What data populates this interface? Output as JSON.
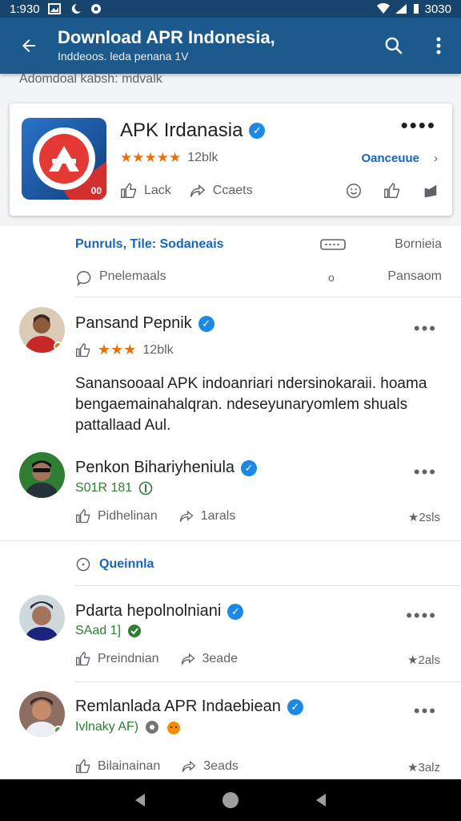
{
  "status_bar": {
    "time": "1:930",
    "right_text": "3030",
    "icons": [
      "photo-icon",
      "moon-icon",
      "location-icon",
      "wifi-icon",
      "signal-icon",
      "battery-icon"
    ]
  },
  "app_bar": {
    "title": "Download APR Indonesia,",
    "subtitle": "Inddeoos. leda penana 1V",
    "icons": [
      "back-arrow-icon",
      "search-icon",
      "more-vert-icon"
    ]
  },
  "breadcrumb": "Adomdoal kabsh: mdvalk",
  "app_card": {
    "name": "APK Irdanasia",
    "rating_stars": "★★★★★",
    "rating_count": "12blk",
    "link_label": "Oanceuue",
    "link_chevron": "›",
    "icon_corner_text": "00",
    "like_label": "Lack",
    "share_label": "Ccaets"
  },
  "info": {
    "row1_left": "Punruls, Tile: Sodaneais",
    "row1_right": "Bornieia",
    "row2_left": "Pnelemaals",
    "row2_mid": "o",
    "row2_right": "Pansaom"
  },
  "posts": [
    {
      "author": "Pansand Pepnik",
      "rating_stars": "★★★",
      "rating_count": "12blk",
      "body": "Sanansooaal APK indoanriari ndersinokaraii. hoama bengaemainahalqran. ndeseyunaryomlem shuals pattallaad Aul.",
      "more": "•••"
    },
    {
      "author": "Penkon Bihariyheniula",
      "meta": "S01R 181",
      "like_label": "Pidhelinan",
      "share_label": "1arals",
      "stat": "★2sls",
      "more": "•••"
    },
    {
      "author": "Pdarta hepolnolniani",
      "meta": "SAad 1]",
      "like_label": "Preindnian",
      "share_label": "3eade",
      "stat": "★2als",
      "more": "••••"
    },
    {
      "author": "Remlanlada APR Indaebiean",
      "meta": "Ivlnaky AF)",
      "like_label": "Bilainainan",
      "share_label": "3eads",
      "stat": "★3alz",
      "more": "•••"
    }
  ],
  "section_link": "Queinnla",
  "colors": {
    "status_bar": "#16446c",
    "app_bar": "#1c5a8e",
    "accent_blue": "#1565c0",
    "star_orange": "#e8710a",
    "green": "#2e7d32",
    "verified_blue": "#1e88e5"
  },
  "nav_bar": {
    "icons": [
      "back-nav-icon",
      "home-nav-icon",
      "recents-nav-icon"
    ]
  }
}
